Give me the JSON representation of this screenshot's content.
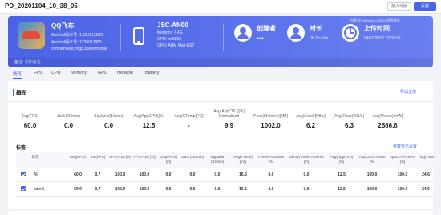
{
  "header": {
    "title": "PD_20201104_10_38_05",
    "join_button": "加入对比",
    "settings_button": "设置"
  },
  "banner": {
    "perfdog_note": "由腾讯PerfDog4.3.200924提供服务",
    "app": {
      "name": "QQ飞车",
      "line1": "Android版本号: 1.22.0.12885",
      "line2": "Android版本号: 1220012885",
      "line3": "com.tencent.tmgp.speedmobile"
    },
    "device": {
      "name": "JSC-AN00",
      "line1": "Memory: 7.4G",
      "line2": "CPU: mt6853",
      "line3": "GPU: ARM Mali-G57"
    },
    "creator": {
      "label": "创建者",
      "value": "●●●"
    },
    "duration": {
      "label": "时长",
      "value": "0h 2m 24s"
    },
    "upload": {
      "label": "上传时间",
      "value": "04/11/2020 10:38:06"
    },
    "note_label": "备注:",
    "note_value": "添加备注"
  },
  "tabs": [
    "概览",
    "FPS",
    "CPU",
    "Memory",
    "GPU",
    "Network",
    "Battery"
  ],
  "overview": {
    "title": "概览",
    "export": "导出全部",
    "metrics": [
      {
        "label": "Avg(FPS)",
        "value": "60.0"
      },
      {
        "label": "Jank(/10min)",
        "value": "0.0"
      },
      {
        "label": "BigJank(/10min)",
        "value": "0.0"
      },
      {
        "label": "Avg(AppCPU)[%]",
        "value": "12.5"
      },
      {
        "label": "Avg(CTemp)[°C]",
        "value": "-"
      },
      {
        "label": "Avg(AppCPU)[%] Normalized",
        "value": "9.9"
      },
      {
        "label": "Peak(Memory)[MB]",
        "value": "1002.0"
      },
      {
        "label": "Avg(Send)[KB/s]",
        "value": "6.2"
      },
      {
        "label": "Avg(Recv)[KB/s]",
        "value": "6.3"
      },
      {
        "label": "Avg(Power)[mW]",
        "value": "2586.6"
      }
    ],
    "labels_title": "标签",
    "param_link": "参数显示设置",
    "columns": [
      "标签",
      "Avg(FPS)",
      "Var(FPS)",
      "FPS>=18 [%]",
      "FPS>=25 [%]",
      "Drop(FPS) [/h]",
      "Jank (/10min)",
      "BigJank (/10min)",
      "Avg(FTime) [ms]",
      "FTime>=100ms [%]",
      "Delta(FTime)>100ms [/h]",
      "Avg(AppCPU) [%]",
      "AppCPU<=60% [%]",
      "AppCPU<=80% [%]",
      "Avg(Tota..."
    ],
    "rows": [
      {
        "name": "All",
        "cells": [
          "60.0",
          "0.7",
          "100.0",
          "100.0",
          "0.0",
          "0.0",
          "0.0",
          "16.6",
          "0.0",
          "0.0",
          "12.5",
          "100.0",
          "100.0",
          "24.6"
        ]
      },
      {
        "name": "label1",
        "cells": [
          "60.0",
          "0.7",
          "100.0",
          "100.0",
          "0.0",
          "0.0",
          "0.0",
          "16.6",
          "0.0",
          "0.0",
          "12.5",
          "100.0",
          "100.0",
          "24.6"
        ]
      }
    ]
  }
}
